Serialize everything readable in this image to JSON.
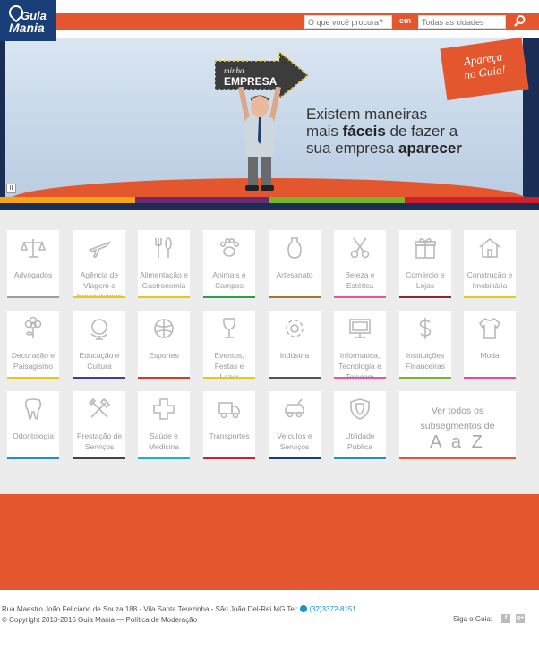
{
  "header": {
    "logo_line1": "Guia",
    "logo_line2": "Mania",
    "search_placeholder": "O que você procura?",
    "em_label": "em",
    "location_placeholder": "Todas as cidades"
  },
  "banner": {
    "sign_small": "minha",
    "sign_big": "EMPRESA",
    "headline_1": "Existem maneiras",
    "headline_2a": "mais ",
    "headline_2b": "fáceis",
    "headline_2c": " de fazer a",
    "headline_3a": "sua empresa ",
    "headline_3b": "aparecer",
    "stamp_line1": "Apareça",
    "stamp_line2": "no Guia!",
    "colors": [
      "#f3a516",
      "#6b2a6e",
      "#7ab42c",
      "#d0202e"
    ]
  },
  "categories": [
    {
      "label": "Advogados",
      "icon": "scales-icon",
      "color": "#9e9e9e"
    },
    {
      "label": "Agência de Viagem e Hospedagem",
      "icon": "airplane-icon",
      "color": "#e8c61a"
    },
    {
      "label": "Alimentação e Gastronomia",
      "icon": "utensils-icon",
      "color": "#e8c61a"
    },
    {
      "label": "Animais e Campos",
      "icon": "paw-icon",
      "color": "#2f9c4a"
    },
    {
      "label": "Artesanato",
      "icon": "vase-icon",
      "color": "#9a7a2e"
    },
    {
      "label": "Beleza e Estética",
      "icon": "scissors-icon",
      "color": "#e8559a"
    },
    {
      "label": "Comércio e Lojas",
      "icon": "gift-icon",
      "color": "#8b2a2a"
    },
    {
      "label": "Construção e Imobiliária",
      "icon": "house-icon",
      "color": "#e8c61a"
    },
    {
      "label": "Decoração e Paisagismo",
      "icon": "flower-icon",
      "color": "#e8c61a"
    },
    {
      "label": "Educação e Cultura",
      "icon": "globe-icon",
      "color": "#4a3aa0"
    },
    {
      "label": "Esportes",
      "icon": "ball-icon",
      "color": "#d03a2a"
    },
    {
      "label": "Eventos, Festas e Lazer",
      "icon": "wineglass-icon",
      "color": "#e8c61a"
    },
    {
      "label": "Indústria",
      "icon": "gear-icon",
      "color": "#555555"
    },
    {
      "label": "Informática, Tecnologia e Telecom",
      "icon": "monitor-icon",
      "color": "#e8559a"
    },
    {
      "label": "Instituições Financeiras",
      "icon": "dollar-icon",
      "color": "#7ab42c"
    },
    {
      "label": "Moda",
      "icon": "shirt-icon",
      "color": "#e84a9a"
    },
    {
      "label": "Odontologia",
      "icon": "tooth-icon",
      "color": "#1b8fcf"
    },
    {
      "label": "Prestação de Serviços",
      "icon": "tools-icon",
      "color": "#444444"
    },
    {
      "label": "Saúde e Medicina",
      "icon": "cross-icon",
      "color": "#1bb3c8"
    },
    {
      "label": "Transportes",
      "icon": "truck-icon",
      "color": "#d0202e"
    },
    {
      "label": "Veículos e Serviços",
      "icon": "car-icon",
      "color": "#1a3e78"
    },
    {
      "label": "Utilidade Pública",
      "icon": "shield-icon",
      "color": "#1b8fcf"
    }
  ],
  "all_tile": {
    "line1": "Ver todos os",
    "line2": "subsegmentos de",
    "az": "A a Z"
  },
  "footer": {
    "address": "Rua Maestro João Feliciano de Souza 188 - Vila Santa Terezinha - São João Del-Rei MG Tel:",
    "phone": "(32)3372-8151",
    "copyright": "© Copyright 2013-2016 Guia Mania — Política de Moderação",
    "follow": "Siga o Guia:",
    "facebook": "f",
    "googleplus": "g+"
  }
}
